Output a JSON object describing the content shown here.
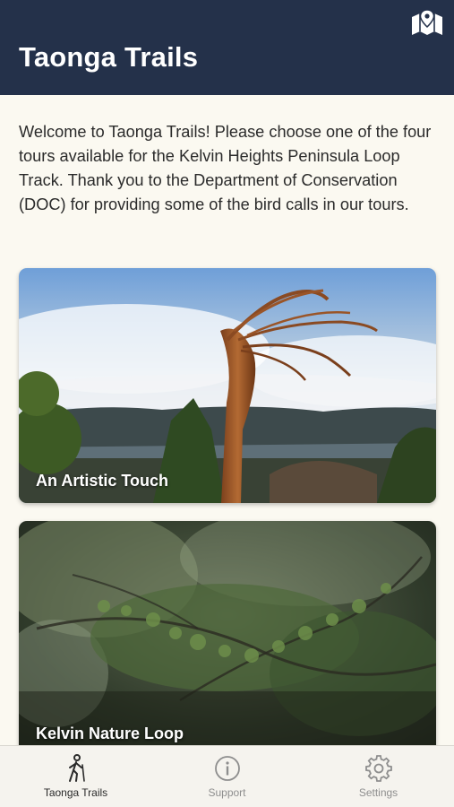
{
  "header": {
    "title": "Taonga Trails",
    "map_icon": "map-pin-icon"
  },
  "intro": {
    "text": "Welcome to Taonga Trails! Please choose one of the four tours available for the Kelvin Heights Peninsula Loop Track. Thank you to the Department of Conservation (DOC) for providing some of the bird calls in our tours."
  },
  "tours": [
    {
      "title": "An Artistic Touch"
    },
    {
      "title": "Kelvin Nature Loop"
    }
  ],
  "tabbar": {
    "tabs": [
      {
        "label": "Taonga Trails",
        "icon": "hiker-icon",
        "active": true
      },
      {
        "label": "Support",
        "icon": "info-icon",
        "active": false
      },
      {
        "label": "Settings",
        "icon": "gear-icon",
        "active": false
      }
    ]
  },
  "colors": {
    "header_bg": "#24314a",
    "page_bg": "#fbf9f1",
    "tab_active": "#2a2a2a",
    "tab_inactive": "#8e8e8e"
  }
}
